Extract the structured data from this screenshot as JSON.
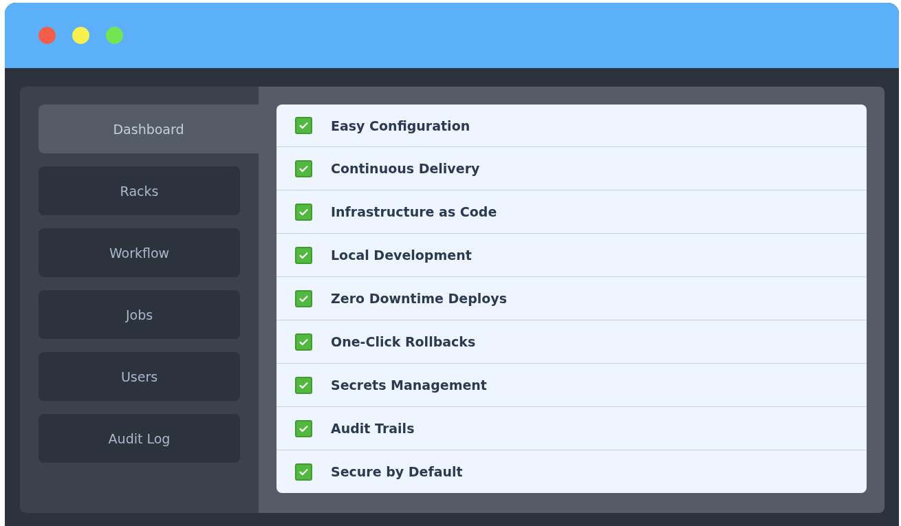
{
  "sidebar": {
    "items": [
      {
        "label": "Dashboard",
        "selected": true
      },
      {
        "label": "Racks",
        "selected": false
      },
      {
        "label": "Workflow",
        "selected": false
      },
      {
        "label": "Jobs",
        "selected": false
      },
      {
        "label": "Users",
        "selected": false
      },
      {
        "label": "Audit Log",
        "selected": false
      }
    ]
  },
  "features": [
    {
      "label": "Easy Configuration",
      "checked": true
    },
    {
      "label": "Continuous Delivery",
      "checked": true
    },
    {
      "label": "Infrastructure as Code",
      "checked": true
    },
    {
      "label": "Local Development",
      "checked": true
    },
    {
      "label": "Zero Downtime Deploys",
      "checked": true
    },
    {
      "label": "One-Click Rollbacks",
      "checked": true
    },
    {
      "label": "Secrets Management",
      "checked": true
    },
    {
      "label": "Audit Trails",
      "checked": true
    },
    {
      "label": "Secure by Default",
      "checked": true
    }
  ]
}
